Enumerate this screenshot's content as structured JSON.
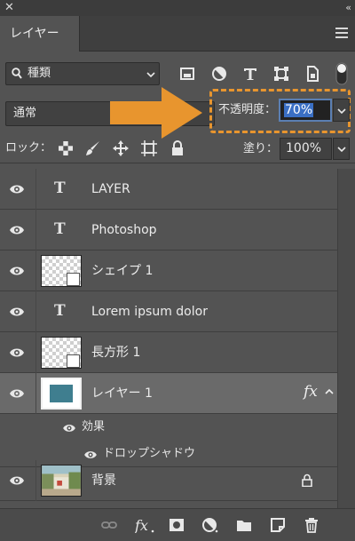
{
  "header": {
    "close_glyph": "✕",
    "collapse_glyph": "‹‹"
  },
  "tab": {
    "label": "レイヤー"
  },
  "filter": {
    "kind_label": "種類",
    "icons": [
      "image-filter-icon",
      "adjustment-filter-icon",
      "type-filter-icon",
      "shape-filter-icon",
      "smart-object-filter-icon",
      "filter-toggle-icon"
    ]
  },
  "blend": {
    "mode": "通常",
    "opacity_label": "不透明度：",
    "opacity_value": "70%"
  },
  "lock": {
    "label": "ロック：",
    "fill_label": "塗り：",
    "fill_value": "100%"
  },
  "layers": [
    {
      "name": "LAYER",
      "kind": "text"
    },
    {
      "name": "Photoshop",
      "kind": "text"
    },
    {
      "name": "シェイプ 1",
      "kind": "shape"
    },
    {
      "name": "Lorem ipsum dolor",
      "kind": "text"
    },
    {
      "name": "長方形 1",
      "kind": "shape"
    },
    {
      "name": "レイヤー 1",
      "kind": "pixel",
      "selected": true,
      "fx": "fx"
    },
    {
      "name": "背景",
      "kind": "background",
      "locked": true
    }
  ],
  "effects": {
    "label": "効果",
    "items": [
      "ドロップシャドウ"
    ]
  },
  "type_icon_glyph": "T",
  "colors": {
    "panel": "#535353",
    "selected_row": "#6a6a6a",
    "highlight": "#e8952e",
    "accent": "#3a6fc4"
  },
  "bottom_icons": [
    "link-layers-icon",
    "fx-icon",
    "mask-icon",
    "adjustment-layer-icon",
    "group-folder-icon",
    "new-layer-icon",
    "trash-icon"
  ]
}
